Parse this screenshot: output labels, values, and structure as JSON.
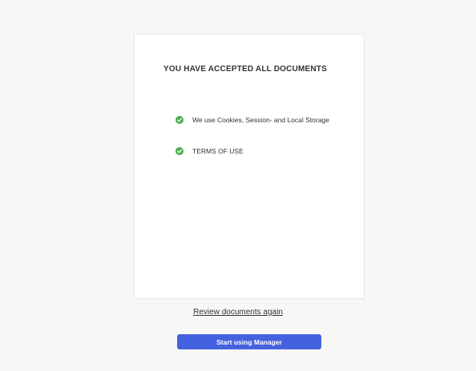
{
  "card": {
    "title": "YOU HAVE ACCEPTED ALL DOCUMENTS",
    "documents": [
      {
        "label": "We use Cookies, Session- and Local Storage",
        "status_icon": "check-circle-icon",
        "status": "accepted"
      },
      {
        "label": "TERMS OF USE",
        "status_icon": "check-circle-icon",
        "status": "accepted"
      }
    ]
  },
  "actions": {
    "review_link": "Review documents again",
    "start_button": "Start using Manager"
  },
  "colors": {
    "background": "#f7f7f7",
    "check": "#4caf50",
    "primary": "#4462e0"
  }
}
